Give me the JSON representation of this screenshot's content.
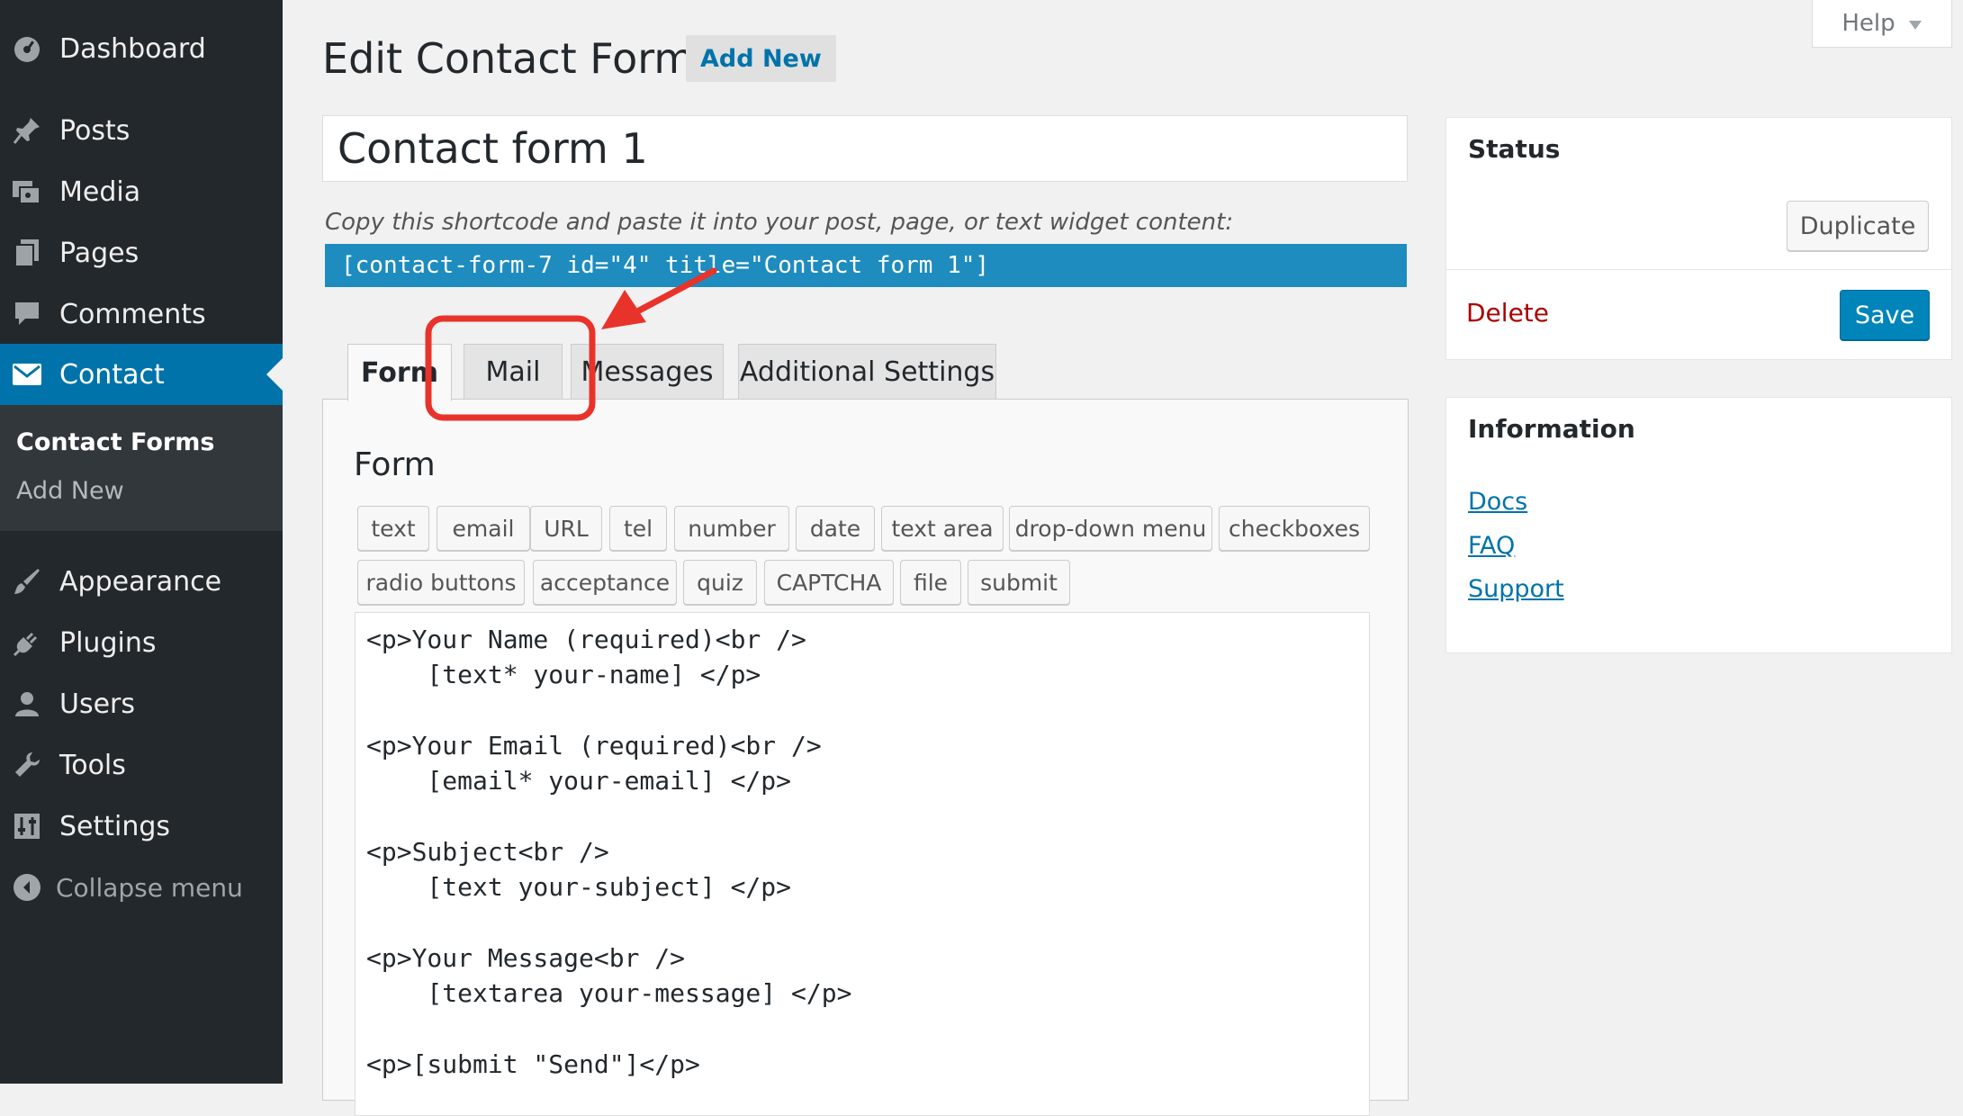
{
  "sidebar": {
    "items": [
      {
        "label": "Dashboard",
        "icon": "dashboard-icon"
      },
      {
        "label": "Posts",
        "icon": "pin-icon"
      },
      {
        "label": "Media",
        "icon": "media-icon"
      },
      {
        "label": "Pages",
        "icon": "pages-icon"
      },
      {
        "label": "Comments",
        "icon": "comment-icon"
      },
      {
        "label": "Contact",
        "icon": "envelope-icon"
      },
      {
        "label": "Appearance",
        "icon": "brush-icon"
      },
      {
        "label": "Plugins",
        "icon": "plug-icon"
      },
      {
        "label": "Users",
        "icon": "user-icon"
      },
      {
        "label": "Tools",
        "icon": "wrench-icon"
      },
      {
        "label": "Settings",
        "icon": "settings-icon"
      }
    ],
    "submenu": [
      "Contact Forms",
      "Add New"
    ],
    "collapse_label": "Collapse menu"
  },
  "header": {
    "title": "Edit Contact Form",
    "add_new": "Add New",
    "help": "Help"
  },
  "form_title": "Contact form 1",
  "shortcode": {
    "label": "Copy this shortcode and paste it into your post, page, or text widget content:",
    "code": "[contact-form-7 id=\"4\" title=\"Contact form 1\"]"
  },
  "tabs": [
    "Form",
    "Mail",
    "Messages",
    "Additional Settings"
  ],
  "active_tab": "Form",
  "form_panel": {
    "heading": "Form",
    "tag_buttons_row1": [
      "text",
      "email",
      "URL",
      "tel",
      "number",
      "date",
      "text area",
      "drop-down menu",
      "checkboxes"
    ],
    "tag_buttons_row2": [
      "radio buttons",
      "acceptance",
      "quiz",
      "CAPTCHA",
      "file",
      "submit"
    ],
    "code": "<p>Your Name (required)<br />\n    [text* your-name] </p>\n\n<p>Your Email (required)<br />\n    [email* your-email] </p>\n\n<p>Subject<br />\n    [text your-subject] </p>\n\n<p>Your Message<br />\n    [textarea your-message] </p>\n\n<p>[submit \"Send\"]</p>"
  },
  "status_box": {
    "title": "Status",
    "duplicate": "Duplicate",
    "delete": "Delete",
    "save": "Save"
  },
  "info_box": {
    "title": "Information",
    "links": [
      "Docs",
      "FAQ",
      "Support"
    ]
  },
  "colors": {
    "sidebar_bg": "#23282d",
    "accent": "#0073aa",
    "shortcode_bg": "#1e8cbe",
    "primary_button": "#0085ba",
    "delete": "#aa0000",
    "annotation": "#e8332b"
  }
}
